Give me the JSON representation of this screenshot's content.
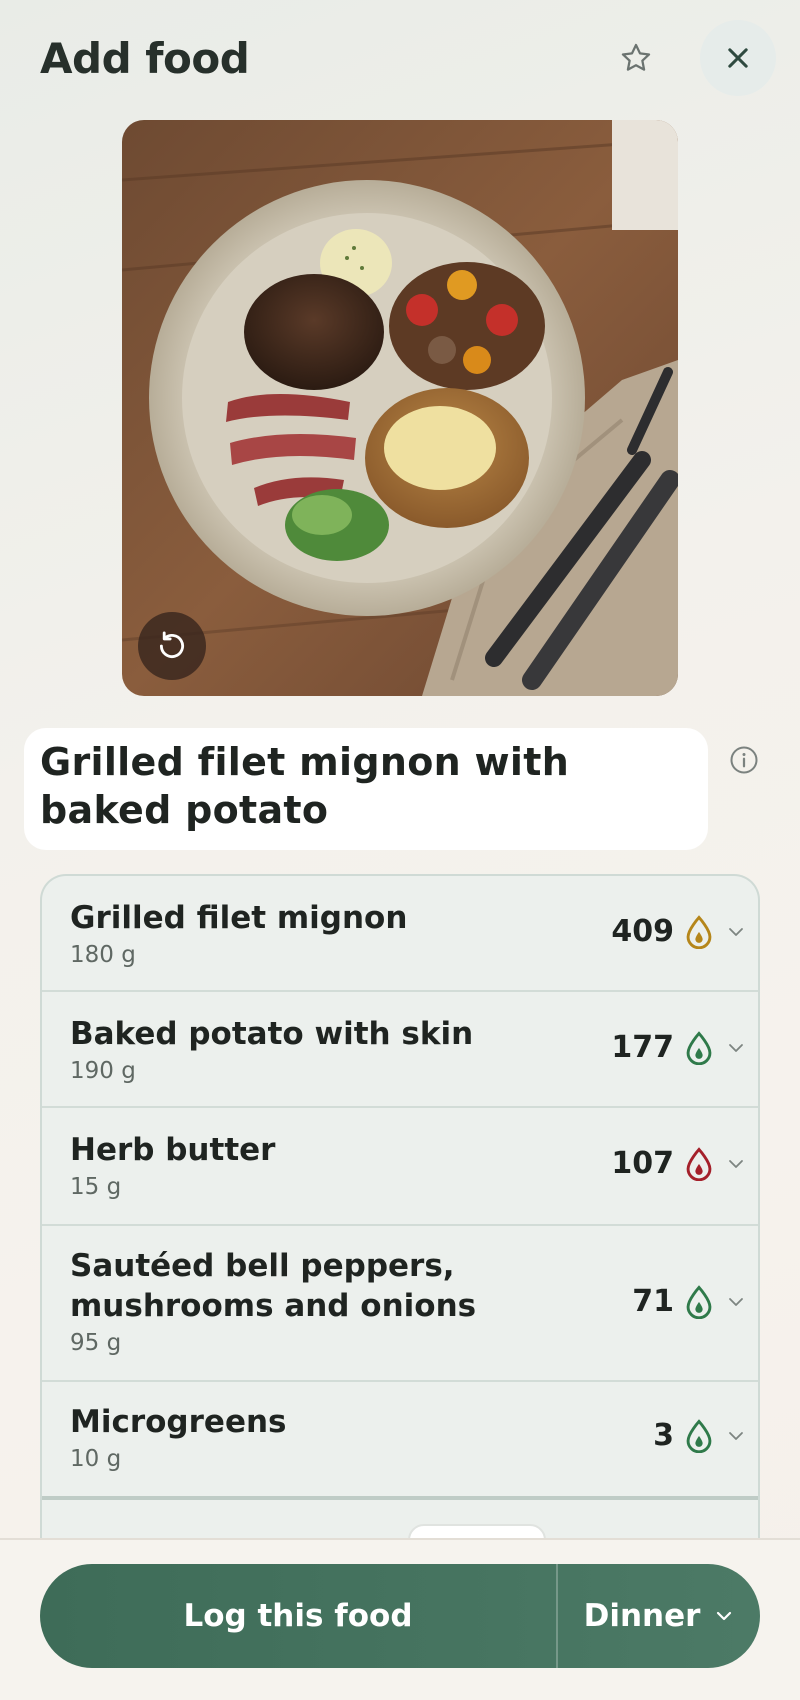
{
  "header": {
    "title": "Add food",
    "favorite_icon": "star-icon",
    "close_icon": "close-icon"
  },
  "photo": {
    "description_icon": "food-photo",
    "retake_icon": "rotate-ccw-icon"
  },
  "meal_name": "Grilled filet mignon with baked potato",
  "info_icon": "info-icon",
  "items": [
    {
      "name": "Grilled filet mignon",
      "weight": "180 g",
      "kcal": "409",
      "drop_color": "#b5861a"
    },
    {
      "name": "Baked potato with skin",
      "weight": "190 g",
      "kcal": "177",
      "drop_color": "#2f7a4a"
    },
    {
      "name": "Herb butter",
      "weight": "15 g",
      "kcal": "107",
      "drop_color": "#a4202a"
    },
    {
      "name_line1": "Sautéed bell peppers,",
      "name_line2": "mushrooms and onions",
      "weight": "95 g",
      "kcal": "71",
      "drop_color": "#2f7a4a"
    },
    {
      "name": "Microgreens",
      "weight": "10 g",
      "kcal": "3",
      "drop_color": "#2f7a4a"
    }
  ],
  "footer": {
    "log_label": "Log this food",
    "meal_label": "Dinner"
  },
  "colors": {
    "accent": "#456f5c",
    "list_bg": "#ecf0ed"
  }
}
